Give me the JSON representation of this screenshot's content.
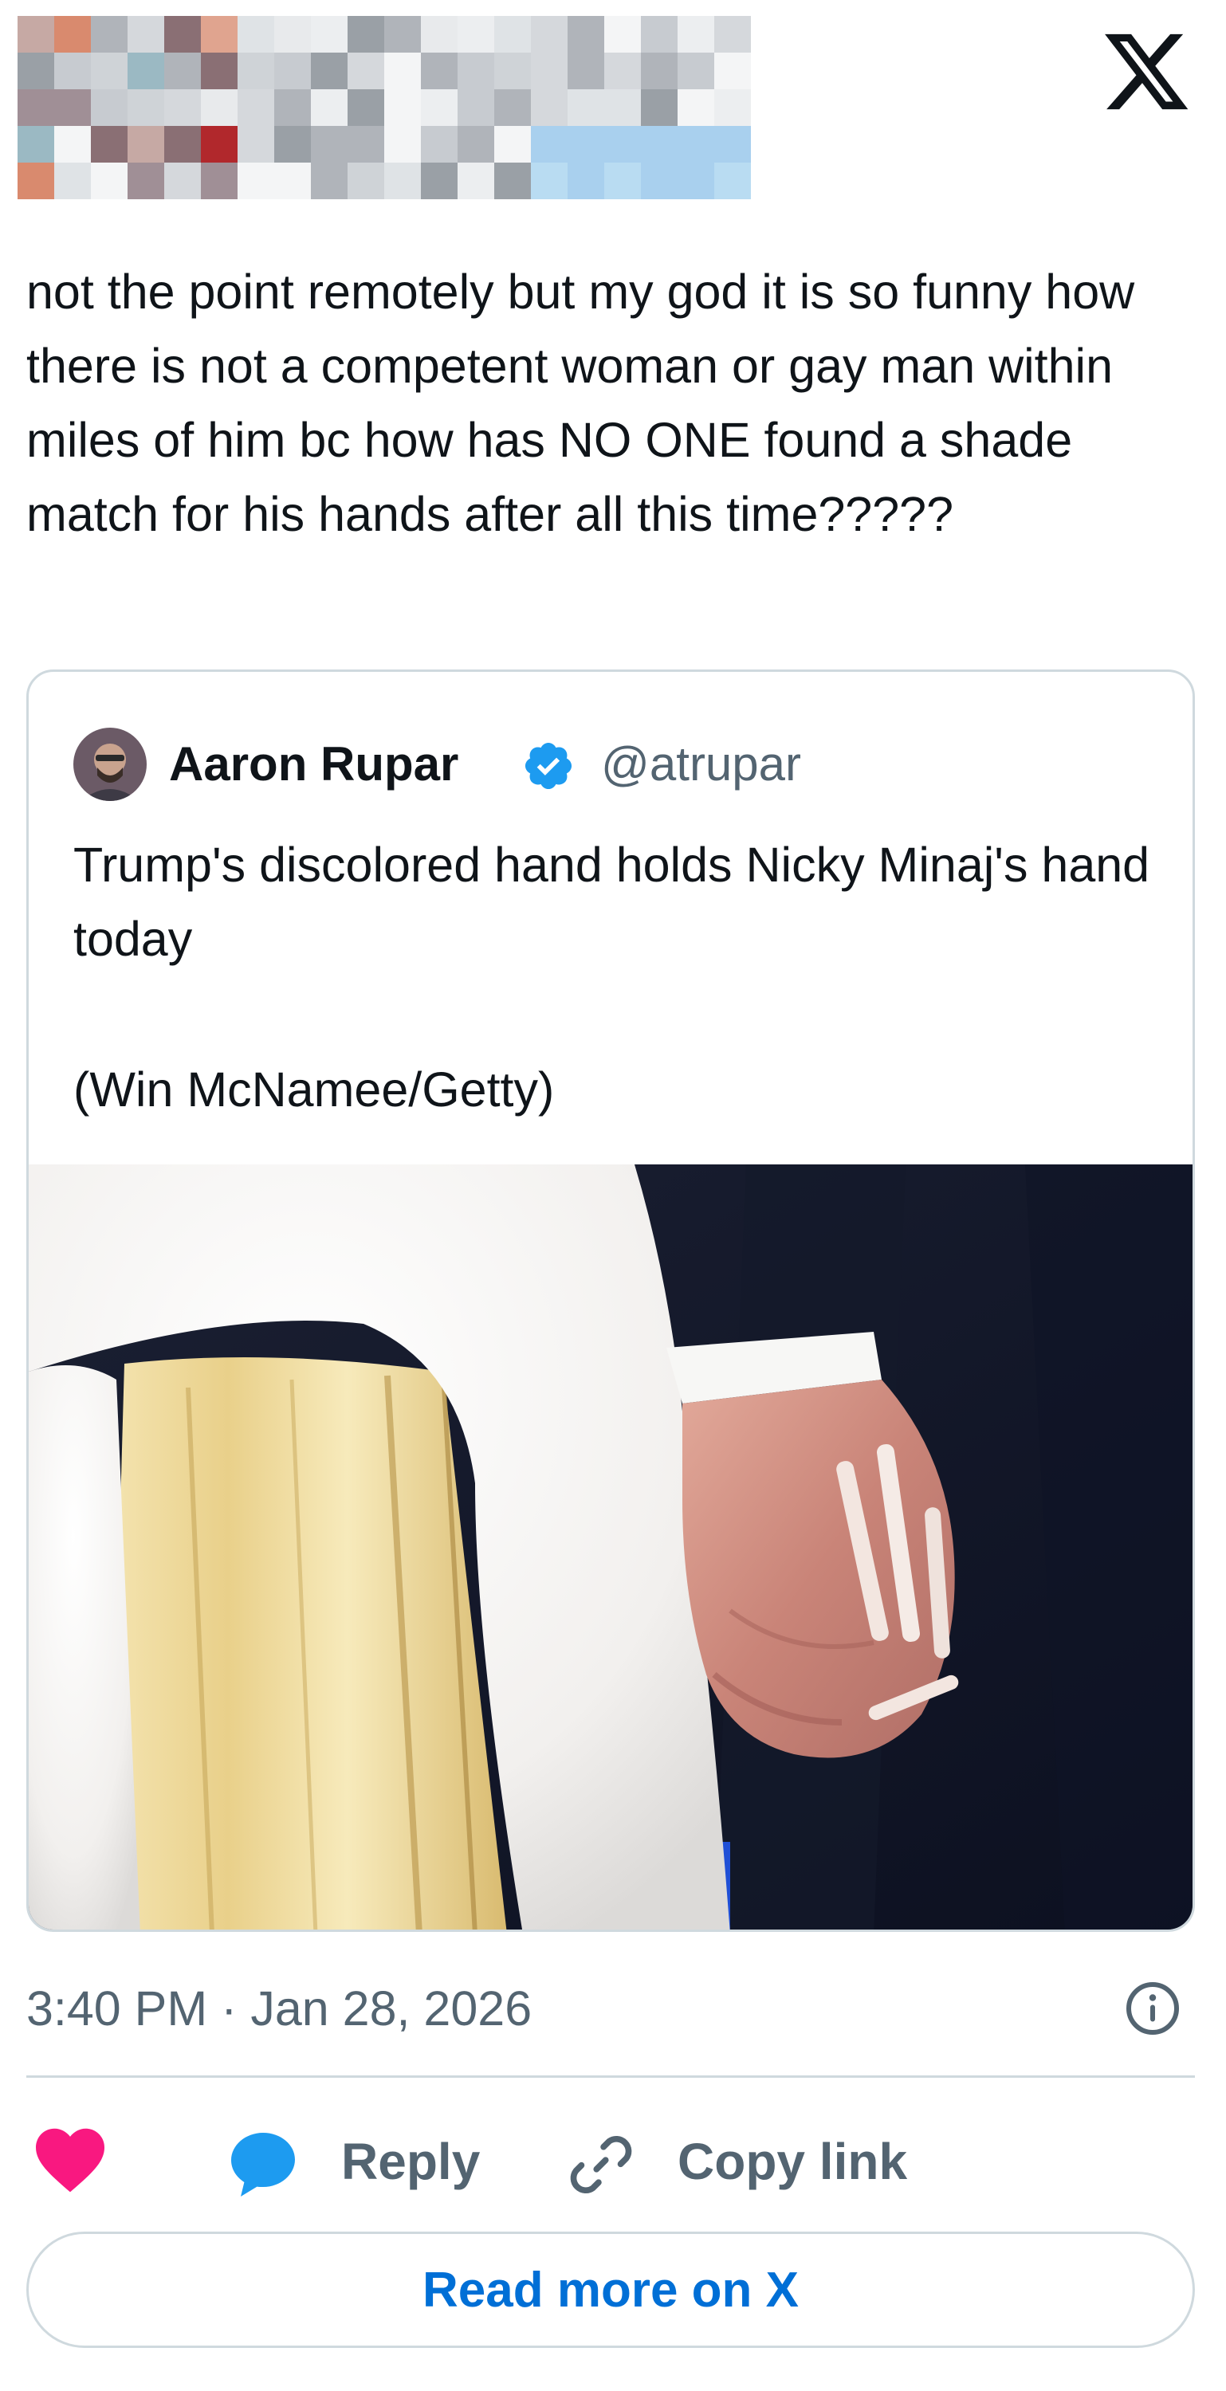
{
  "tweet": {
    "text": "not the point remotely but my god it is so funny how there is not a competent woman or gay man within miles of him bc how has NO ONE found a shade match for his hands after all this time?????",
    "timestamp": "3:40 PM · Jan 28, 2026"
  },
  "quoted_tweet": {
    "author_name": "Aaron Rupar",
    "handle": "@atrupar",
    "verified": true,
    "text": "Trump's discolored hand holds Nicky Minaj's hand today",
    "credit": "(Win McNamee/Getty)"
  },
  "actions": {
    "reply_label": "Reply",
    "copy_link_label": "Copy link",
    "read_more_label": "Read more on X"
  },
  "icons": {
    "platform_logo": "x-logo-icon",
    "like": "heart-icon",
    "reply": "speech-bubble-icon",
    "copy_link": "link-icon",
    "info": "info-icon",
    "verified": "verified-badge-icon"
  },
  "colors": {
    "text": "#0f1419",
    "secondary_text": "#536471",
    "border": "#cfd9de",
    "like": "#f91880",
    "reply": "#1d9bf0",
    "verified": "#1d9bf0",
    "link_blue": "#006fd6"
  }
}
